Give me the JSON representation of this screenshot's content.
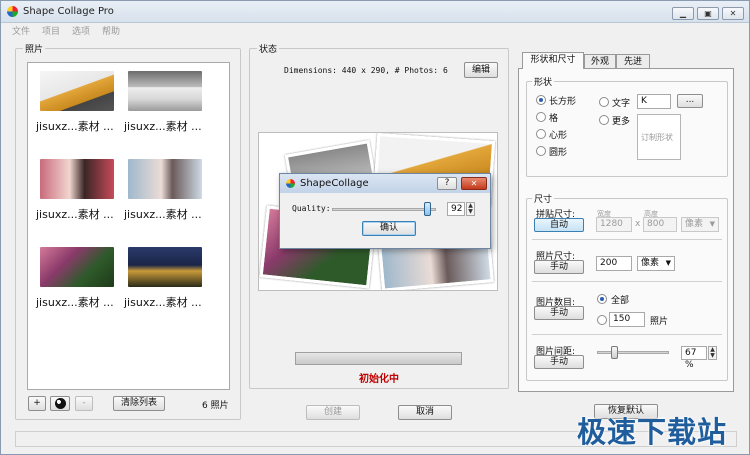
{
  "window": {
    "title": "Shape Collage Pro",
    "min_icon": "minimize-icon",
    "max_icon": "maximize-icon",
    "close_icon": "close-icon"
  },
  "menu": [
    "文件",
    "项目",
    "选项",
    "帮助"
  ],
  "photos": {
    "label": "照片",
    "items": [
      {
        "caption": "jisuxz...素材 ...",
        "color": "#d9a63a"
      },
      {
        "caption": "jisuxz...素材 ...",
        "color": "#cfcfcf"
      },
      {
        "caption": "jisuxz...素材 ...",
        "color": "#c9778a"
      },
      {
        "caption": "jisuxz...素材 ...",
        "color": "#b9c9d9"
      },
      {
        "caption": "jisuxz...素材 ...",
        "color": "#8a4a6a"
      },
      {
        "caption": "jisuxz...素材 ...",
        "color": "#1e2a4a"
      }
    ],
    "add_label": "+",
    "remove_label": "-",
    "clear_label": "清除列表",
    "count_label": "6 照片"
  },
  "status": {
    "label": "状态",
    "dimensions": "Dimensions: 440 x 290, # Photos: 6",
    "edit_label": "编辑",
    "progress_text": "初始化中",
    "progress": 0,
    "create_label": "创建",
    "cancel_label": "取消"
  },
  "dialog": {
    "title": "ShapeCollage",
    "help_label": "?",
    "quality_label": "Quality:",
    "quality_value": "92",
    "quality_fraction": 0.92,
    "ok_label": "确认"
  },
  "tabs": [
    "形状和尺寸",
    "外观",
    "先进"
  ],
  "shape": {
    "label": "形状",
    "options": [
      "长方形",
      "格",
      "心形",
      "圆形"
    ],
    "selected": "长方形",
    "text_label": "文字",
    "text_value": "K",
    "more_label": "更多",
    "more_btn": "...",
    "custom_label": "订制形状"
  },
  "size": {
    "label": "尺寸",
    "collage_size_label": "拼贴尺寸:",
    "auto_label": "自动",
    "width_label": "宽度",
    "height_label": "高度",
    "width_value": "1280",
    "height_value": "800",
    "x_label": "x",
    "unit_label": "像素",
    "photo_size_label": "照片尺寸:",
    "manual_label": "手动",
    "photo_size_value": "200",
    "photo_unit_label": "像素",
    "photo_count_label": "图片数目:",
    "all_label": "全部",
    "count_value": "150",
    "count_unit": "照片",
    "spacing_label": "图片间距:",
    "spacing_value": "67 %",
    "spacing_fraction": 0.25
  },
  "restore_label": "恢复默认",
  "watermark": "极速下载站"
}
